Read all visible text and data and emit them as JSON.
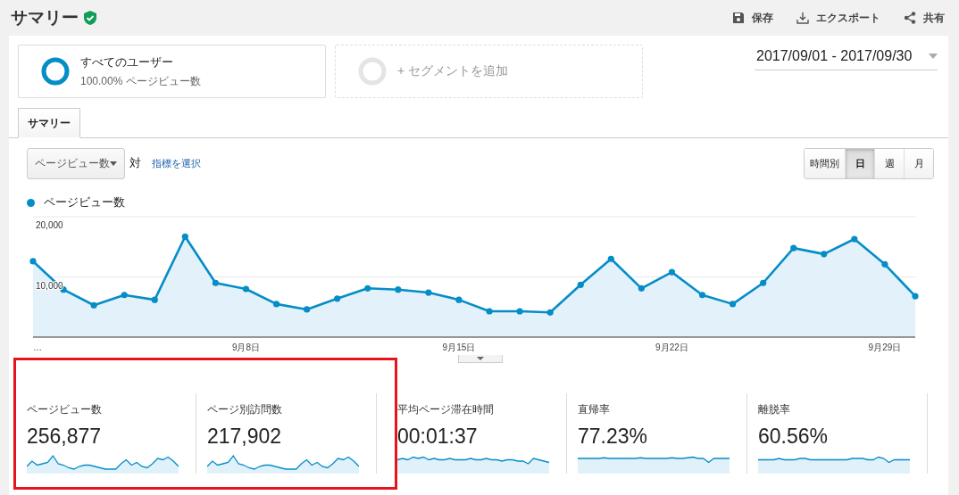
{
  "header": {
    "title": "サマリー",
    "actions": [
      {
        "kind": "save",
        "label": "保存"
      },
      {
        "kind": "export",
        "label": "エクスポート"
      },
      {
        "kind": "share",
        "label": "共有"
      }
    ]
  },
  "segments": [
    {
      "kind": "active",
      "name": "すべてのユーザー",
      "detail": "100.00% ページビュー数"
    },
    {
      "kind": "add",
      "label": "+ セグメントを追加"
    }
  ],
  "date_range": "2017/09/01 - 2017/09/30",
  "tabs": [
    {
      "label": "サマリー",
      "selected": true
    }
  ],
  "metric_selector": {
    "value": "ページビュー数",
    "vs": "対",
    "link": "指標を選択"
  },
  "granularity": [
    {
      "label": "時間別",
      "selected": false
    },
    {
      "label": "日",
      "selected": true
    },
    {
      "label": "週",
      "selected": false
    },
    {
      "label": "月",
      "selected": false
    }
  ],
  "chart": {
    "chart_data": {
      "type": "area",
      "categories": [
        "…",
        null,
        null,
        null,
        null,
        null,
        null,
        "9月8日",
        null,
        null,
        null,
        null,
        null,
        null,
        "9月15日",
        null,
        null,
        null,
        null,
        null,
        null,
        "9月22日",
        null,
        null,
        null,
        null,
        null,
        null,
        "9月29日",
        null
      ],
      "ylim": [
        0,
        20000
      ],
      "yticks": [
        {
          "value": 10000,
          "label": "10,000"
        },
        {
          "value": 20000,
          "label": "20,000"
        }
      ],
      "series": [
        {
          "name": "ページビュー数",
          "color": "#058dc7",
          "values": [
            12600,
            7900,
            5300,
            7000,
            6200,
            16700,
            9000,
            8000,
            5500,
            4600,
            6400,
            8100,
            7900,
            7400,
            6200,
            4300,
            4300,
            4100,
            8700,
            13000,
            8100,
            10800,
            7000,
            5500,
            9000,
            14800,
            13800,
            16300,
            12100,
            6800
          ]
        }
      ]
    }
  },
  "metrics": [
    {
      "label": "ページビュー数",
      "value": "256,877",
      "highlighted": true
    },
    {
      "label": "ページ別訪問数",
      "value": "217,902",
      "highlighted": true
    },
    {
      "label": "平均ページ滞在時間",
      "value": "00:01:37",
      "highlighted": false
    },
    {
      "label": "直帰率",
      "value": "77.23%",
      "highlighted": false
    },
    {
      "label": "離脱率",
      "value": "60.56%",
      "highlighted": false
    }
  ]
}
